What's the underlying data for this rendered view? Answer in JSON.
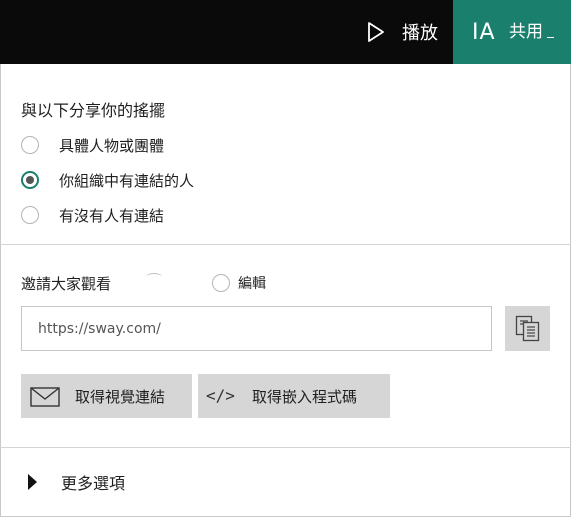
{
  "header": {
    "play_label": "播放",
    "avatar_initials": "IA",
    "share_label": "共用",
    "accent_color": "#1a7f6d",
    "bar_color": "#0a0a0a"
  },
  "share_with": {
    "title": "與以下分享你的搖擺",
    "options": [
      {
        "label": "具體人物或團體",
        "selected": false
      },
      {
        "label": "你組織中有連結的人",
        "selected": true
      },
      {
        "label": "有沒有人有連結",
        "selected": false
      }
    ]
  },
  "invite": {
    "label": "邀請大家觀看",
    "edit_label": "編輯",
    "url_value": "https://sway.com/"
  },
  "buttons": {
    "visual_link_label": "取得視覺連結",
    "embed_code_label": "取得嵌入程式碼",
    "embed_icon": "</>"
  },
  "more": {
    "label": "更多選項"
  }
}
